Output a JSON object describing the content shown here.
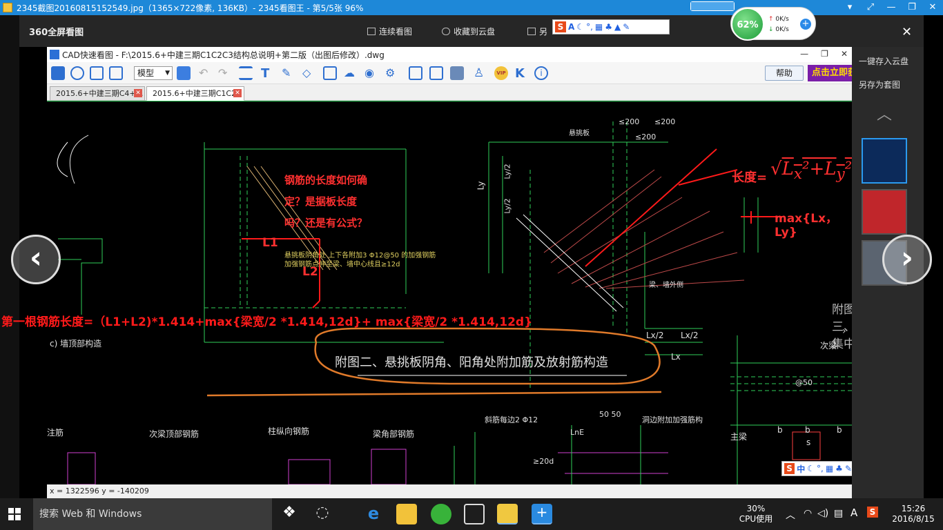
{
  "viewer": {
    "title": "2345截图20160815152549.jpg（1365×722像素, 136KB）- 2345看图王 - 第5/5张 96%",
    "controls": [
      "▾",
      "⤢",
      "—",
      "❐",
      "✕"
    ]
  },
  "toolbar": {
    "logo": "360全屏看图",
    "items": [
      "连续看图",
      "收藏到云盘",
      "另"
    ],
    "close": "✕"
  },
  "speed": {
    "cpu_percent": "62%",
    "up": "0K/s",
    "down": "0K/s"
  },
  "cad": {
    "title": "CAD快速看图 - F:\\2015.6+中建三期C1C2C3结构总说明+第二版（出图后修改）.dwg",
    "model_select": "模型",
    "help": "帮助",
    "ad": "点击立即获取",
    "tabs": [
      "2015.6+中建三期C4+…",
      "2015.6+中建三期C1C2·"
    ],
    "status": "x = 1322596  y = -140209",
    "drawing": {
      "notes_red": [
        "钢筋的长度如何确",
        "定？是据板长度",
        "吗？还是有公式？"
      ],
      "label_l1": "L1",
      "label_l2": "L2",
      "formula_length": "长度=",
      "formula_max": "max{Lx，Ly}",
      "formula_first": "第一根钢筋长度=（L1+L2)*1.414+max{梁宽/2 *1.414,12d}+   max{梁宽/2  *1.414,12d}",
      "caption": "附图二、悬挑板阴角、阳角处附加筋及放射筋构造",
      "label_lx2a": "Lx/2",
      "label_lx2b": "Lx/2",
      "label_lx": "Lx",
      "label_ly": "Ly",
      "label_ly2a": "Ly/2",
      "label_ly2b": "Ly/2",
      "dim_200a": "≤200",
      "dim_200b": "≤200",
      "dim_200c": "≤200",
      "note_yellow": "悬挑板阴角处 上下各附加3 Φ12@50 的加强钢筋",
      "note_yellow2": "加强钢筋点伸至梁、墙中心线且≥12d",
      "label_xuantiban": "悬挑板",
      "label_liang": "梁、墙外侧",
      "label_zhu": "次梁",
      "label_zhuliang": "主梁",
      "label_c": "c) 墙顶部构造",
      "label_fu3": "附图三、集中",
      "bottom_labels": [
        "注筋",
        "次梁顶部钢筋",
        "柱纵向钢筋",
        "梁角部钢筋",
        "斜筋每边2 Φ12",
        "洞边附加加强筋构"
      ],
      "label_b": [
        "b",
        "b",
        "b"
      ],
      "label_s": "s",
      "label_at50": "@50",
      "label_2d": "≥20d",
      "label_5050": "50 50",
      "label_lne": "LnE"
    }
  },
  "side_panel": {
    "save_cloud": "一键存入云盘",
    "save_as": "另存为套图"
  },
  "ime": {
    "logo": "S",
    "lang": "中"
  },
  "taskbar": {
    "search_placeholder": "搜索 Web 和 Windows",
    "cpu_percent": "30%",
    "cpu_label": "CPU使用",
    "ime": "A",
    "time": "15:26",
    "date": "2016/8/15"
  }
}
